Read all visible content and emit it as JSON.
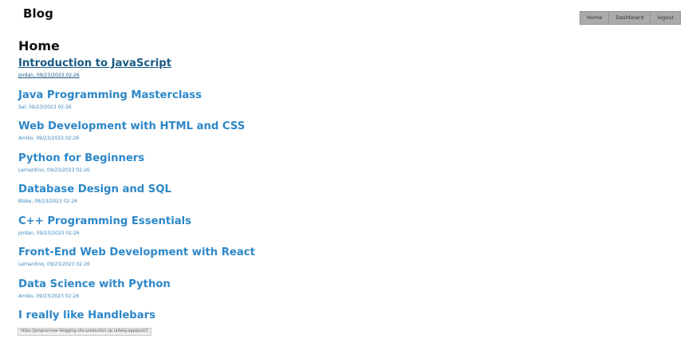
{
  "header": {
    "site_title": "Blog",
    "nav": {
      "home_label": "Home",
      "dashboard_label": "Dashboard",
      "logout_label": "logout"
    }
  },
  "main": {
    "heading": "Home",
    "posts": [
      {
        "title": "Introduction to JavaScript",
        "meta": "Jordan, 09/23/2023 02:26"
      },
      {
        "title": "Java Programming Masterclass",
        "meta": "Sal, 09/23/2023 02:26"
      },
      {
        "title": "Web Development with HTML and CSS",
        "meta": "Amiko, 09/23/2023 02:26"
      },
      {
        "title": "Python for Beginners",
        "meta": "Lernantino, 09/23/2023 02:26"
      },
      {
        "title": "Database Design and SQL",
        "meta": "Blake, 09/23/2023 02:26"
      },
      {
        "title": "C++ Programming Essentials",
        "meta": "Jordan, 09/23/2023 02:26"
      },
      {
        "title": "Front-End Web Development with React",
        "meta": "Lernantino, 09/23/2023 02:26"
      },
      {
        "title": "Data Science with Python",
        "meta": "Amiko, 09/23/2023 02:26"
      },
      {
        "title": "I really like Handlebars",
        "meta": ""
      }
    ]
  },
  "status_bar": {
    "url": "https://programmer-blogging-site-production.up.railway.app/post/1"
  },
  "colors": {
    "link": "#2d87c8",
    "link_visited_hover": "#1a5a85",
    "nav_background": "#ababab"
  }
}
